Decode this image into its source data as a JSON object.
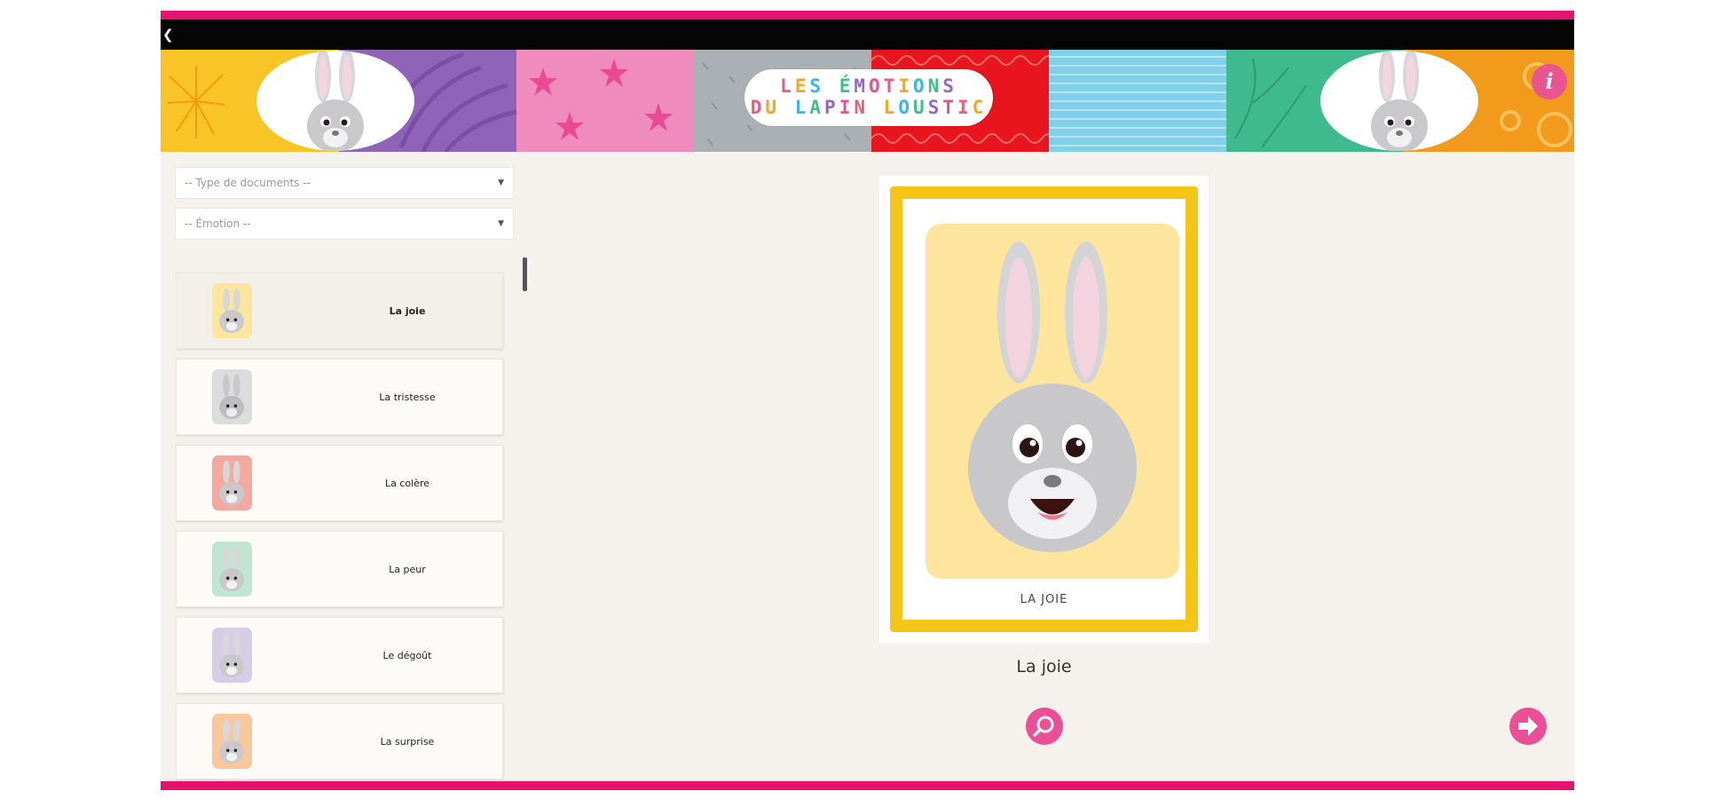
{
  "header": {
    "logo_line1": "LES ÉMOTIONS",
    "logo_line2": "DU LAPIN LOUSTIC",
    "info_label": "i"
  },
  "filters": {
    "doc_type_placeholder": "-- Type de documents --",
    "emotion_placeholder": "-- Émotion --"
  },
  "sidebar": {
    "items": [
      {
        "label": "La joie",
        "color": "#fde59e",
        "selected": true
      },
      {
        "label": "La tristesse",
        "color": "#dcdcdc",
        "selected": false
      },
      {
        "label": "La colère",
        "color": "#f5a99e",
        "selected": false
      },
      {
        "label": "La peur",
        "color": "#bfe6d2",
        "selected": false
      },
      {
        "label": "Le dégoût",
        "color": "#d8cde6",
        "selected": false
      },
      {
        "label": "La surprise",
        "color": "#f9c79a",
        "selected": false
      }
    ]
  },
  "card": {
    "caption": "LA JOIE",
    "title": "La joie"
  },
  "colors": {
    "accent": "#e5136f",
    "button": "#ec4f97",
    "card_border": "#f5c518"
  },
  "icons": {
    "back": "back-arrow-icon",
    "info": "info-icon",
    "zoom": "magnifier-icon",
    "next": "arrow-right-icon"
  }
}
